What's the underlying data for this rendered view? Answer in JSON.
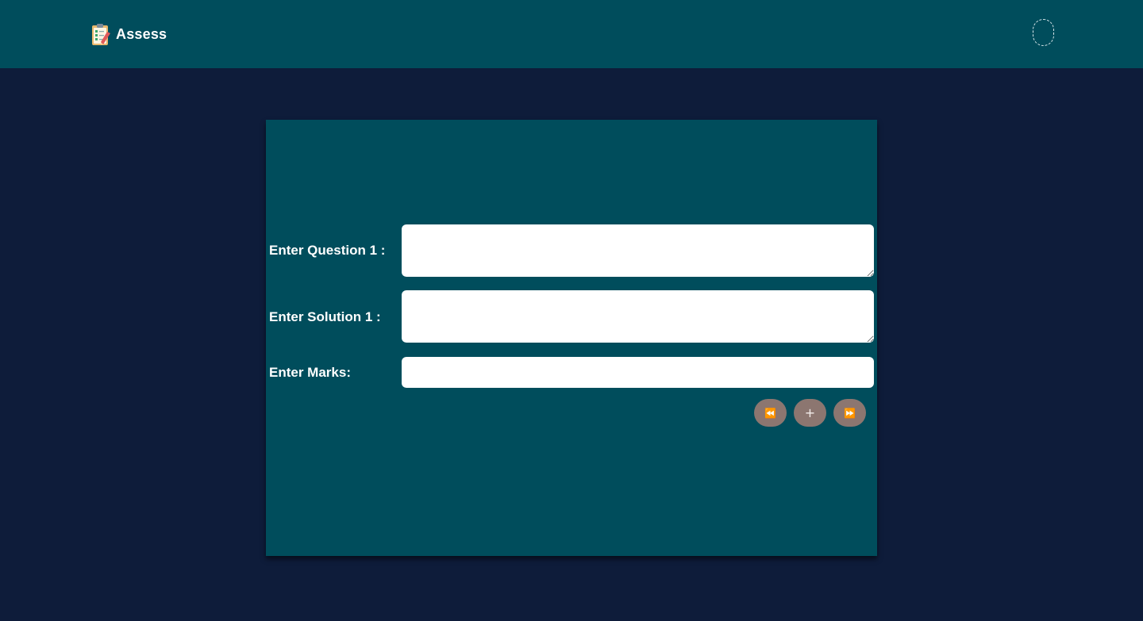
{
  "header": {
    "brand_text": "Assess",
    "brand_icon": "clipboard-checklist-icon",
    "menu_icon": "menu-toggle-icon"
  },
  "form": {
    "question_label": "Enter Question 1 :",
    "question_value": "",
    "solution_label": "Enter Solution 1 :",
    "solution_value": "",
    "marks_label": "Enter Marks:",
    "marks_value": ""
  },
  "controls": {
    "prev_glyph": "⏪",
    "add_glyph": "+",
    "next_glyph": "⏩"
  },
  "colors": {
    "page_background": "#0e1c3a",
    "header_background": "#004d5c",
    "panel_background": "#004d5c",
    "button_background": "#8c7670"
  }
}
